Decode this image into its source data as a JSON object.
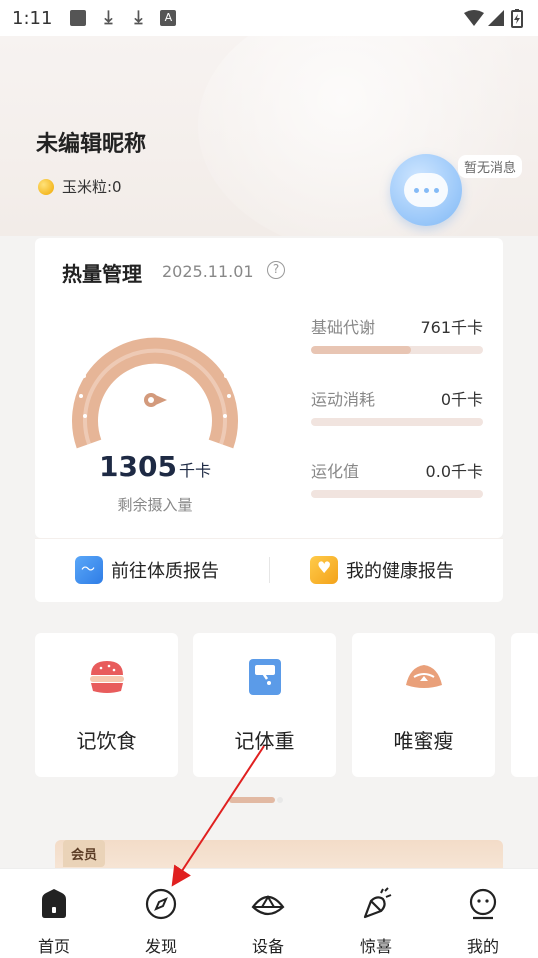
{
  "status_bar": {
    "time": "1:11"
  },
  "profile": {
    "nickname": "未编辑昵称",
    "coins": "玉米粒:0",
    "message_tag": "暂无消息"
  },
  "calorie_card": {
    "title": "热量管理",
    "date": "2025.11.01",
    "remaining_value": "1305",
    "remaining_unit": "千卡",
    "remaining_label": "剩余摄入量",
    "metrics": [
      {
        "label": "基础代谢",
        "value": "761千卡",
        "progress": 0.58
      },
      {
        "label": "运动消耗",
        "value": "0千卡",
        "progress": 0
      },
      {
        "label": "运化值",
        "value": "0.0千卡",
        "progress": 0
      }
    ]
  },
  "reports": {
    "body_report": "前往体质报告",
    "health_report": "我的健康报告"
  },
  "tiles": [
    {
      "label": "记饮食",
      "icon": "food-icon"
    },
    {
      "label": "记体重",
      "icon": "scale-icon"
    },
    {
      "label": "唯蜜瘦",
      "icon": "bread-icon"
    }
  ],
  "member": {
    "tag": "会员"
  },
  "tabbar": [
    {
      "label": "首页",
      "icon": "home-icon"
    },
    {
      "label": "发现",
      "icon": "compass-icon"
    },
    {
      "label": "设备",
      "icon": "device-icon"
    },
    {
      "label": "惊喜",
      "icon": "party-icon"
    },
    {
      "label": "我的",
      "icon": "face-icon"
    }
  ],
  "colors": {
    "accent": "#e8c5b3",
    "gauge": "#e0a987",
    "arrow": "#e02020"
  }
}
